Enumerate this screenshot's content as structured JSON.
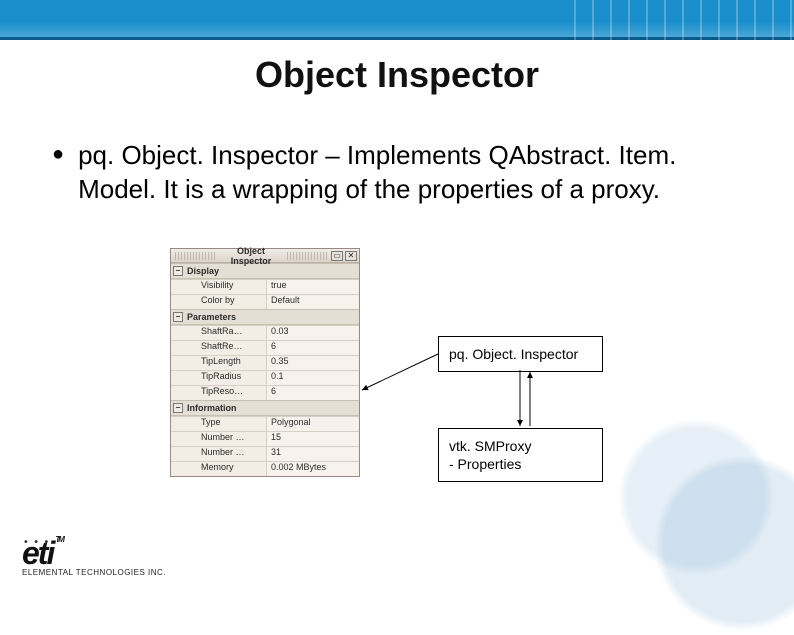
{
  "title": "Object Inspector",
  "bullet": "pq. Object. Inspector – Implements QAbstract. Item. Model.  It is a wrapping of the properties of a proxy.",
  "inspector": {
    "panel_title": "Object Inspector",
    "sections": [
      {
        "name": "Display",
        "rows": [
          {
            "label": "Visibility",
            "value": "true"
          },
          {
            "label": "Color by",
            "value": "Default"
          }
        ]
      },
      {
        "name": "Parameters",
        "rows": [
          {
            "label": "ShaftRa…",
            "value": "0.03"
          },
          {
            "label": "ShaftRe…",
            "value": "6"
          },
          {
            "label": "TipLength",
            "value": "0.35"
          },
          {
            "label": "TipRadius",
            "value": "0.1"
          },
          {
            "label": "TipReso…",
            "value": "6"
          }
        ]
      },
      {
        "name": "Information",
        "rows": [
          {
            "label": "Type",
            "value": "Polygonal"
          },
          {
            "label": "Number …",
            "value": "15"
          },
          {
            "label": "Number …",
            "value": "31"
          },
          {
            "label": "Memory",
            "value": "0.002 MBytes"
          }
        ]
      }
    ]
  },
  "diagram": {
    "box_a": "pq. Object. Inspector",
    "box_b_line1": "vtk. SMProxy",
    "box_b_line2": "- Properties"
  },
  "logo": {
    "mark": "eti",
    "tm": "TM",
    "sub": "ELEMENTAL TECHNOLOGIES INC."
  },
  "icons": {
    "minus": "−",
    "maximize": "▭",
    "close": "✕"
  }
}
